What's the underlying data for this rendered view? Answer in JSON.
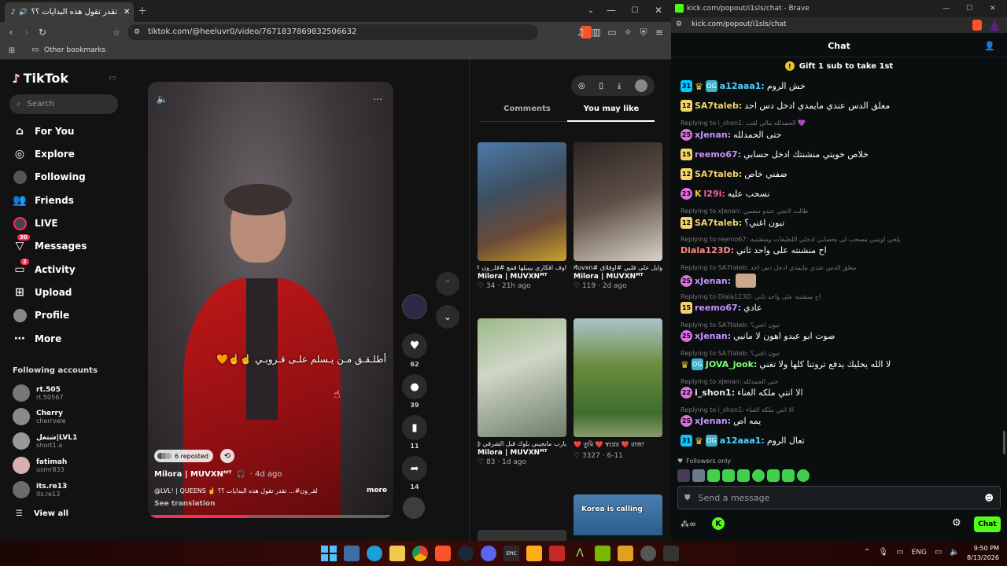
{
  "browser": {
    "tab_title": "تقدر تقول هذه البدايات ؟؟ @LVL",
    "url": "tiktok.com/@heeluvr0/video/7671837869832506632",
    "bookmarks_label": "Other bookmarks"
  },
  "tiktok": {
    "logo": "TikTok",
    "search_placeholder": "Search",
    "nav": [
      {
        "label": "For You",
        "icon": "home-icon"
      },
      {
        "label": "Explore",
        "icon": "compass-icon"
      },
      {
        "label": "Following",
        "icon": "following-icon"
      },
      {
        "label": "Friends",
        "icon": "friends-icon"
      },
      {
        "label": "LIVE",
        "icon": "live-icon"
      },
      {
        "label": "Messages",
        "icon": "messages-icon",
        "badge": "30"
      },
      {
        "label": "Activity",
        "icon": "activity-icon",
        "badge": "2"
      },
      {
        "label": "Upload",
        "icon": "upload-icon"
      },
      {
        "label": "Profile",
        "icon": "profile-icon"
      },
      {
        "label": "More",
        "icon": "more-icon"
      }
    ],
    "following_accounts_label": "Following accounts",
    "accounts": [
      {
        "name": "rt.505",
        "handle": "rt.50567"
      },
      {
        "name": "Cherry",
        "handle": "cherrvele"
      },
      {
        "name": "شتغل|LVL1",
        "handle": "short1.a"
      },
      {
        "name": "fatimah",
        "handle": "usmr833"
      },
      {
        "name": "its.re13",
        "handle": "its.re13"
      }
    ],
    "view_all": "View all",
    "video": {
      "caption_overlay": "أطلـقـق مـن يـسلم علـى قـروبـي ☝️☝️🧡",
      "reposted": "6 reposted",
      "author": "Milora | MUVXNᴹᵀ",
      "age": "4d ago",
      "description": "@LVL¹ | QUEENS ☝️ لقـ_ون#... تقدر تقول هذه البدايات ؟؟",
      "more": "more",
      "see_translation": "See translation",
      "likes": "62",
      "comments": "39",
      "saves": "11",
      "shares": "14"
    },
    "tabs": [
      "Comments",
      "You may like"
    ],
    "suggested": [
      {
        "caption": "اوف افكاري ييبيلها قمع #قلـ_ون #Muvx #داز",
        "author": "Milora | MUVXNᴹᵀ",
        "views": "34",
        "age": "21h ago"
      },
      {
        "caption": "وايل على قلبي #اوقلاق #Muvxn #كلان سيلـ_ون",
        "author": "Milora | MUVXNᴹᵀ",
        "views": "119",
        "age": "2d ago"
      },
      {
        "caption": "يارب مابجيني بلوك قبل الشرقي @oFLaG #قلـ_ون",
        "author": "Milora | MUVXNᴹᵀ",
        "views": "83",
        "age": "1d ago"
      },
      {
        "caption": "তুমি ❤️ স্বপ্নের ❤️ রাজা ❤️",
        "author": "",
        "views": "3327",
        "age": "6-11"
      }
    ],
    "fifth_card_text": "Korea is calling"
  },
  "kick": {
    "window_title": "kick.com/popout/i1sls/chat - Brave",
    "url": "kick.com/popout/i1sls/chat",
    "chat_title": "Chat",
    "pinned": "Gift 1 sub to take 1st",
    "messages": [
      {
        "badge": "31",
        "user": "a12aaa1:",
        "text": "خش الروم",
        "color": "#4fd6ff"
      },
      {
        "badge": "12",
        "user": "SA7taleb:",
        "text": "معلق الدس عندي مايمدي ادخل دس احد",
        "color": "#f5d36b"
      },
      {
        "reply": "Replying to i_shon1: الحمدلله مالي لقب 💜",
        "badge": "25",
        "user": "xJenan:",
        "text": "حتى الحمدلله",
        "color": "#c792ff"
      },
      {
        "badge": "15",
        "user": "reemo67:",
        "text": "خلاص خويتي منشنتك ادخل حسابي",
        "color": "#c792ff"
      },
      {
        "badge": "12",
        "user": "SA7taleb:",
        "text": "ضفني خاص",
        "color": "#f5d36b"
      },
      {
        "badge": "23",
        "user": "l29i:",
        "text": "نسحب عليه",
        "color": "#ff5fa2"
      },
      {
        "reply": "Replying to xJenan: طالب لاتجي عندو سعمي",
        "badge": "12",
        "user": "SA7taleb:",
        "text": "تبون اغني؟",
        "color": "#f5d36b"
      },
      {
        "reply": "Replying to reemo67: يلخي اويتيي مسحب لي بحسابي ادخلي اللطيفات ومنشنيه",
        "badge": "",
        "user": "Diala123D:",
        "text": "اح منشنته على واحد ثاني",
        "color": "#ff8a80"
      },
      {
        "reply": "Replying to SA7taleb: معلق الدس عندي مايمدي ادخل دس احد",
        "badge": "25",
        "user": "xJenan:",
        "text": "",
        "color": "#c792ff"
      },
      {
        "reply": "Replying to Diala123D: اح منشنته على واحد ثاني",
        "badge": "15",
        "user": "reemo67:",
        "text": "عادي",
        "color": "#c792ff"
      },
      {
        "reply": "Replying to SA7taleb: تبون اغني؟",
        "badge": "25",
        "user": "xJenan:",
        "text": "صوت ابو عبدو اهون لا مانبي",
        "color": "#c792ff"
      },
      {
        "reply": "Replying to SA7taleb: تبون اغني؟",
        "badge": "",
        "user": "JOVA_jook:",
        "text": "لا الله يخليك يدفع تروتنا كلها ولا تغني",
        "color": "#7dff7a"
      },
      {
        "reply": "Replying to xJenan: حتى الحمدلله",
        "badge": "22",
        "user": "i_shon1:",
        "text": "الا انتي ملكه الغناء",
        "color": "#e8e8e8"
      },
      {
        "reply": "Replying to i_shon1: الا انتي ملكة الغناء",
        "badge": "25",
        "user": "xJenan:",
        "text": "يمه اص",
        "color": "#c792ff"
      },
      {
        "badge": "31",
        "user": "a12aaa1:",
        "text": "تعال الروم",
        "color": "#4fd6ff"
      }
    ],
    "followers_only": "Followers only",
    "input_placeholder": "Send a message",
    "chat_button": "Chat"
  },
  "taskbar": {
    "lang": "ENG",
    "time": "9:50 PM",
    "date": "8/13/2026"
  },
  "colors": {
    "kick_green": "#53fc18",
    "tiktok_red": "#fe2c55"
  }
}
